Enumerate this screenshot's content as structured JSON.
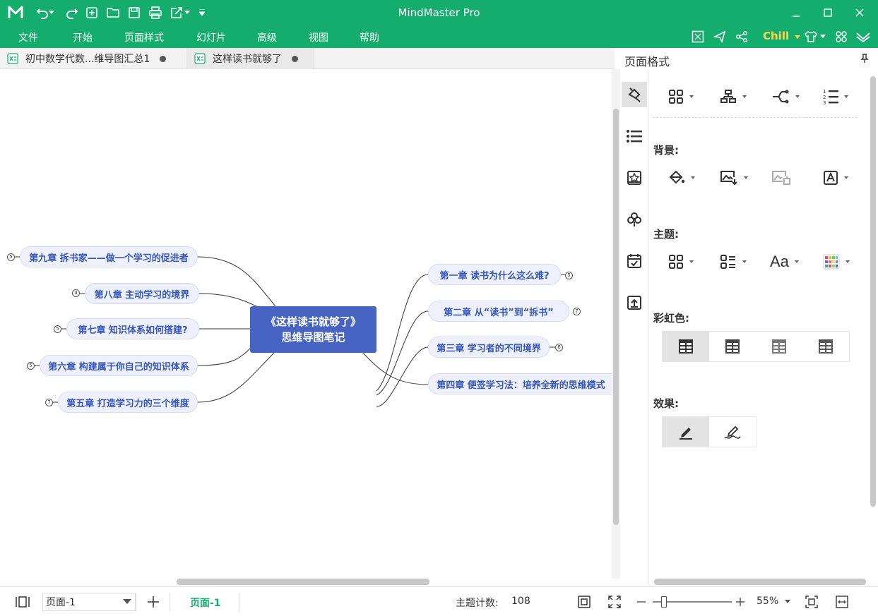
{
  "app": {
    "title": "MindMaster Pro",
    "accent": "#14ad6e",
    "quick_access": [
      "logo-icon",
      "undo-icon",
      "redo-icon",
      "new-icon",
      "open-icon",
      "save-icon",
      "print-icon",
      "export-icon",
      "more-icon"
    ]
  },
  "menu": {
    "items": [
      "文件",
      "开始",
      "页面样式",
      "幻灯片",
      "高级",
      "视图",
      "帮助"
    ],
    "theme_label": "Chill"
  },
  "tabs": [
    {
      "label": "初中数学代数...维导图汇总1"
    },
    {
      "label": "这样读书就够了"
    }
  ],
  "mindmap": {
    "center": {
      "line1": "《这样读书就够了》",
      "line2": "思维导图笔记",
      "color": "#4764c3"
    },
    "right": [
      {
        "label": "第一章 读书为什么这么难?",
        "count": "5"
      },
      {
        "label": "第二章 从“读书”到“拆书”",
        "count": "7"
      },
      {
        "label": "第三章 学习者的不同境界",
        "count": "6"
      },
      {
        "label": "第四章 便签学习法：培养全新的思维模式",
        "count": ""
      }
    ],
    "left": [
      {
        "label": "第九章 拆书家——做一个学习的促进者",
        "count": "5"
      },
      {
        "label": "第八章 主动学习的境界",
        "count": "4"
      },
      {
        "label": "第七章 知识体系如何搭建?",
        "count": "5"
      },
      {
        "label": "第六章 构建属于你自己的知识体系",
        "count": "5"
      },
      {
        "label": "第五章 打造学习力的三个维度",
        "count": "7"
      }
    ]
  },
  "panel": {
    "title": "页面格式",
    "sections": {
      "background": "背景:",
      "theme": "主题:",
      "rainbow": "彩虹色:",
      "effect": "效果:"
    },
    "theme_font_label": "Aa"
  },
  "status": {
    "page_select": "页面-1",
    "page_tab": "页面-1",
    "topic_count_label": "主题计数:",
    "topic_count": "108",
    "zoom": "55%",
    "zoom_level": 0.12
  }
}
